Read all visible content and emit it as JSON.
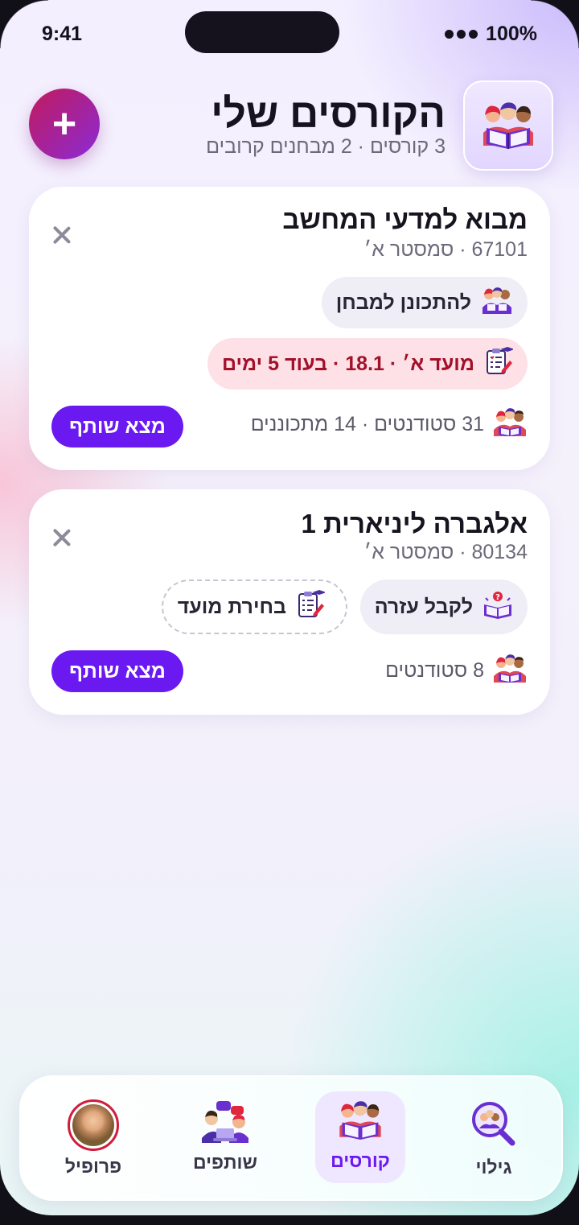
{
  "status": {
    "time": "9:41",
    "battery": "100%"
  },
  "header": {
    "title": "הקורסים שלי",
    "subtitle": "3 קורסים · 2 מבחנים קרובים",
    "add_label": "+"
  },
  "courses": [
    {
      "title": "מבוא למדעי המחשב",
      "subtitle": "67101 · סמסטר א׳",
      "actions": [
        {
          "label": "להתכונן למבחן",
          "icon": "study-group-icon"
        },
        {
          "label": "מועד א׳ · 18.1 · בעוד 5 ימים",
          "icon": "exam-checklist-icon",
          "color": "#a3102a"
        }
      ],
      "meta": "31 סטודנטים · 14 מתכוננים",
      "cta": "מצא שותף"
    },
    {
      "title": "אלגברה ליניארית 1",
      "subtitle": "80134 · סמסטר א׳",
      "actions": [
        {
          "label": "לקבל עזרה",
          "icon": "help-book-icon"
        },
        {
          "label": "בחירת מועד",
          "icon": "exam-checklist-icon"
        }
      ],
      "meta": "8 סטודנטים",
      "cta": "מצא שותף"
    }
  ],
  "tabs": [
    {
      "label": "גילוי",
      "icon": "discover-magnifier-icon"
    },
    {
      "label": "קורסים",
      "icon": "courses-reading-icon",
      "active": true
    },
    {
      "label": "שותפים",
      "icon": "partners-chat-icon"
    },
    {
      "label": "פרופיל",
      "icon": "profile-avatar-icon"
    }
  ],
  "colors": {
    "accent": "#6a19f0",
    "danger": "#a3102a",
    "add_gradient_start": "#c21a5c",
    "add_gradient_end": "#8a2bd6"
  }
}
